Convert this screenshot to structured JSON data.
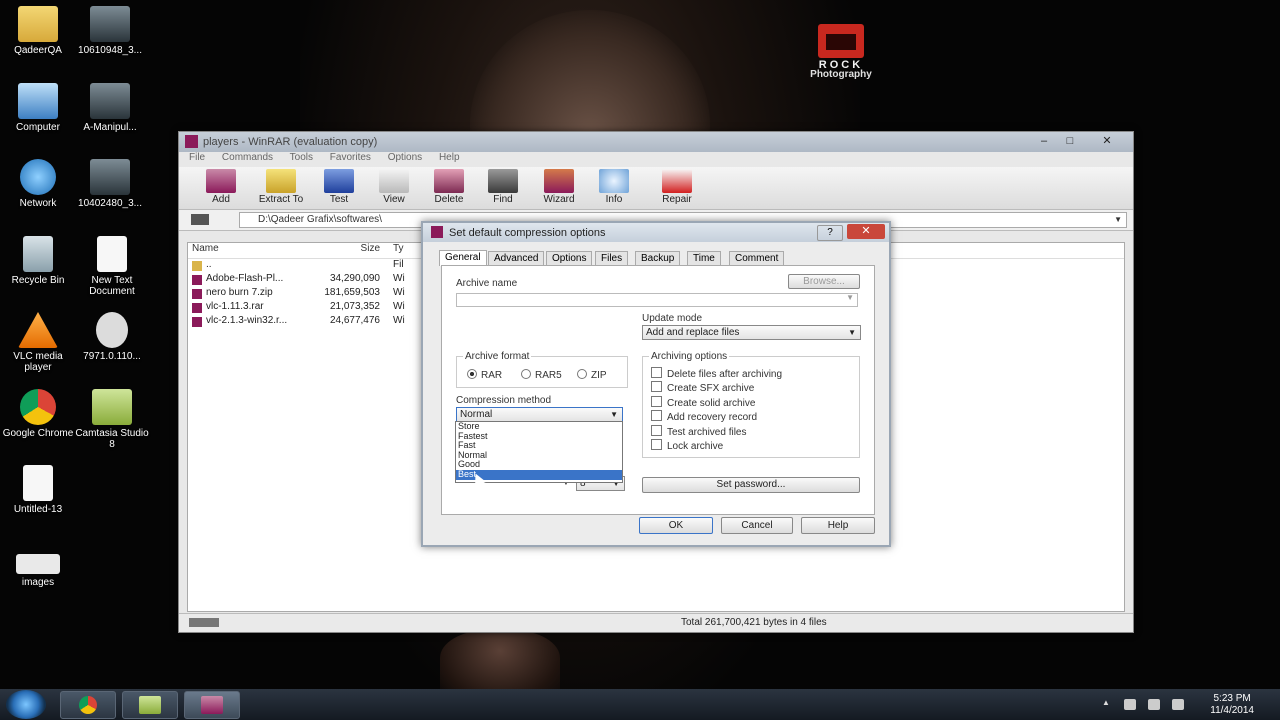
{
  "desktop": {
    "icons": [
      {
        "label": "QadeerQA",
        "icon": "folder-icon"
      },
      {
        "label": "10610948_3...",
        "icon": "video-icon"
      },
      {
        "label": "Computer",
        "icon": "computer-icon"
      },
      {
        "label": "A-Manipul...",
        "icon": "video-icon"
      },
      {
        "label": "Network",
        "icon": "network-icon"
      },
      {
        "label": "10402480_3...",
        "icon": "video-icon"
      },
      {
        "label": "Recycle Bin",
        "icon": "recycle-bin-icon"
      },
      {
        "label": "New Text Document",
        "icon": "text-document-icon"
      },
      {
        "label": "VLC media player",
        "icon": "vlc-icon"
      },
      {
        "label": "7971.0.110...",
        "icon": "ie-file-icon"
      },
      {
        "label": "Google Chrome",
        "icon": "chrome-icon"
      },
      {
        "label": "Camtasia Studio 8",
        "icon": "camtasia-icon"
      },
      {
        "label": "Untitled-13",
        "icon": "document-icon"
      },
      {
        "label": "images",
        "icon": "image-icon"
      }
    ],
    "wallpaper_logo": {
      "line1": "ROCK",
      "line2": "Photography"
    }
  },
  "winrar": {
    "title": "players - WinRAR (evaluation copy)",
    "menu": [
      "File",
      "Commands",
      "Tools",
      "Favorites",
      "Options",
      "Help"
    ],
    "toolbar": [
      "Add",
      "Extract To",
      "Test",
      "View",
      "Delete",
      "Find",
      "Wizard",
      "Info",
      "Repair"
    ],
    "path": "D:\\Qadeer Grafix\\softwares\\",
    "columns": {
      "name": "Name",
      "size": "Size",
      "type": "Ty"
    },
    "files": [
      {
        "name": "..",
        "size": "",
        "type": "Fil"
      },
      {
        "name": "Adobe-Flash-Pl...",
        "size": "34,290,090",
        "type": "Wi"
      },
      {
        "name": "nero burn 7.zip",
        "size": "181,659,503",
        "type": "Wi"
      },
      {
        "name": "vlc-1.11.3.rar",
        "size": "21,073,352",
        "type": "Wi"
      },
      {
        "name": "vlc-2.1.3-win32.r...",
        "size": "24,677,476",
        "type": "Wi"
      }
    ],
    "status": "Total 261,700,421 bytes in 4 files"
  },
  "dialog": {
    "title": "Set default compression options",
    "help_glyph": "?",
    "close_glyph": "✕",
    "tabs": [
      "General",
      "Advanced",
      "Options",
      "Files",
      "Backup",
      "Time",
      "Comment"
    ],
    "archive_name_label": "Archive name",
    "browse_label": "Browse...",
    "update_mode_label": "Update mode",
    "update_mode_value": "Add and replace files",
    "archive_format_label": "Archive format",
    "formats": [
      "RAR",
      "RAR5",
      "ZIP"
    ],
    "selected_format": "RAR",
    "compression_method_label": "Compression method",
    "compression_method_value": "Normal",
    "compression_options": [
      "Store",
      "Fastest",
      "Fast",
      "Normal",
      "Good",
      "Best"
    ],
    "highlighted_option": "Best",
    "dictionary_value": "8",
    "archiving_options_label": "Archiving options",
    "archiving_options": [
      "Delete files after archiving",
      "Create SFX archive",
      "Create solid archive",
      "Add recovery record",
      "Test archived files",
      "Lock archive"
    ],
    "set_password_label": "Set password...",
    "ok_label": "OK",
    "cancel_label": "Cancel",
    "help_label": "Help"
  },
  "taskbar": {
    "clock_time": "5:23 PM",
    "clock_date": "11/4/2014"
  }
}
